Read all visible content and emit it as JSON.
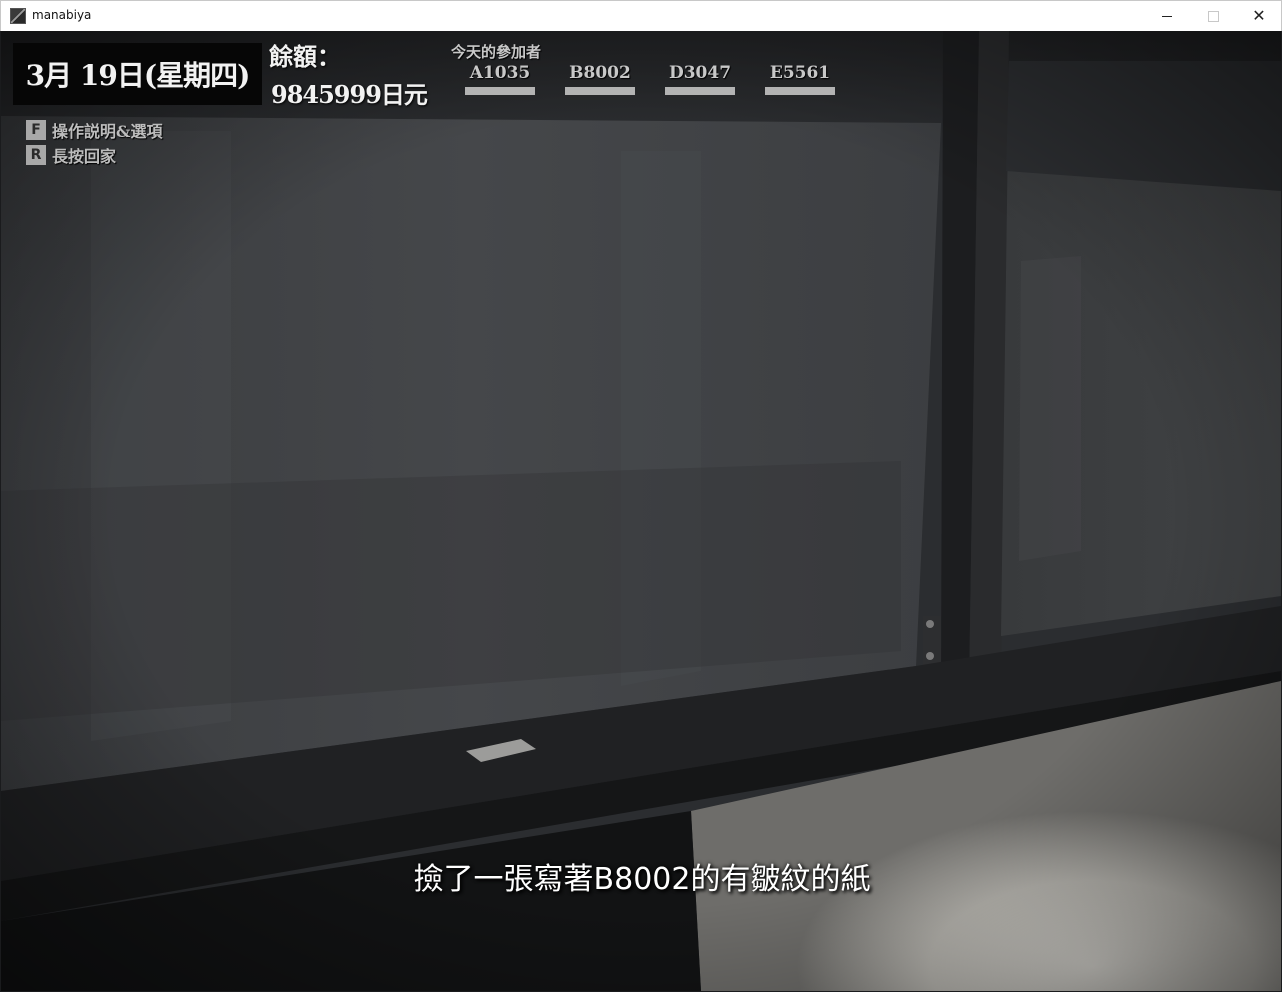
{
  "window": {
    "title": "manabiya",
    "icon": "app-icon",
    "controls": [
      "minimize-icon",
      "maximize-icon",
      "close-icon"
    ],
    "close_glyph": "✕"
  },
  "hud": {
    "date": "3月 19日(星期四)",
    "balance_label": "餘額：",
    "balance_value": "9845999日元",
    "participants_title": "今天的參加者",
    "participants": [
      {
        "id": "A1035"
      },
      {
        "id": "B8002"
      },
      {
        "id": "D3047"
      },
      {
        "id": "E5561"
      }
    ],
    "hints": [
      {
        "key": "F",
        "label": "操作説明&選項"
      },
      {
        "key": "R",
        "label": "長按回家"
      }
    ]
  },
  "subtitle": "撿了一張寫著B8002的有皺紋的紙",
  "colors": {
    "date_box_bg": "#060606",
    "hud_text": "#f2f2f2",
    "participant_text": "#c8c8c8",
    "participant_bar": "#b3b3b3",
    "key_bg": "#a8a8a8"
  }
}
